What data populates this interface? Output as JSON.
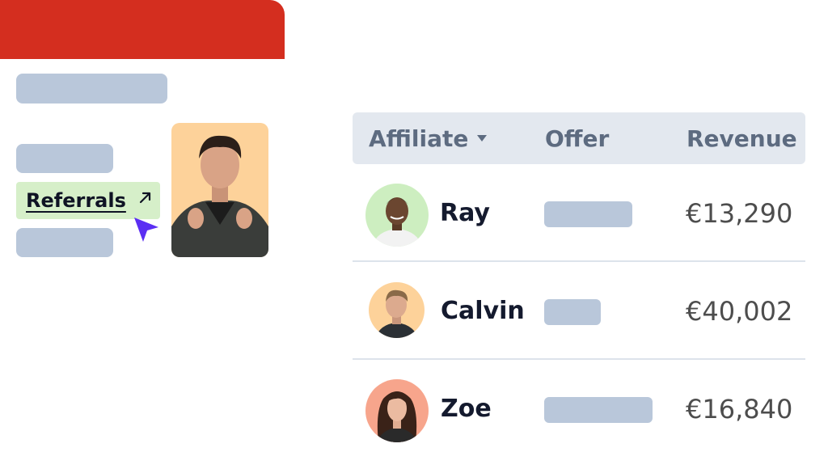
{
  "brand": {
    "accent": "#d42e1f",
    "highlight": "#d6efc9",
    "cursor": "#5b2ef3"
  },
  "sidebar": {
    "active_item": {
      "label": "Referrals",
      "icon": "external-arrow-icon"
    }
  },
  "table": {
    "headers": {
      "affiliate": "Affiliate",
      "offer": "Offer",
      "revenue": "Revenue"
    },
    "sort_icon": "caret-down-icon",
    "rows": [
      {
        "name": "Ray",
        "revenue": "€13,290",
        "avatar_bg": "#cdeec0"
      },
      {
        "name": "Calvin",
        "revenue": "€40,002",
        "avatar_bg": "#fdd29a"
      },
      {
        "name": "Zoe",
        "revenue": "€16,840",
        "avatar_bg": "#f7a58c"
      }
    ]
  },
  "profile_card": {
    "bg": "#fdd29a"
  }
}
